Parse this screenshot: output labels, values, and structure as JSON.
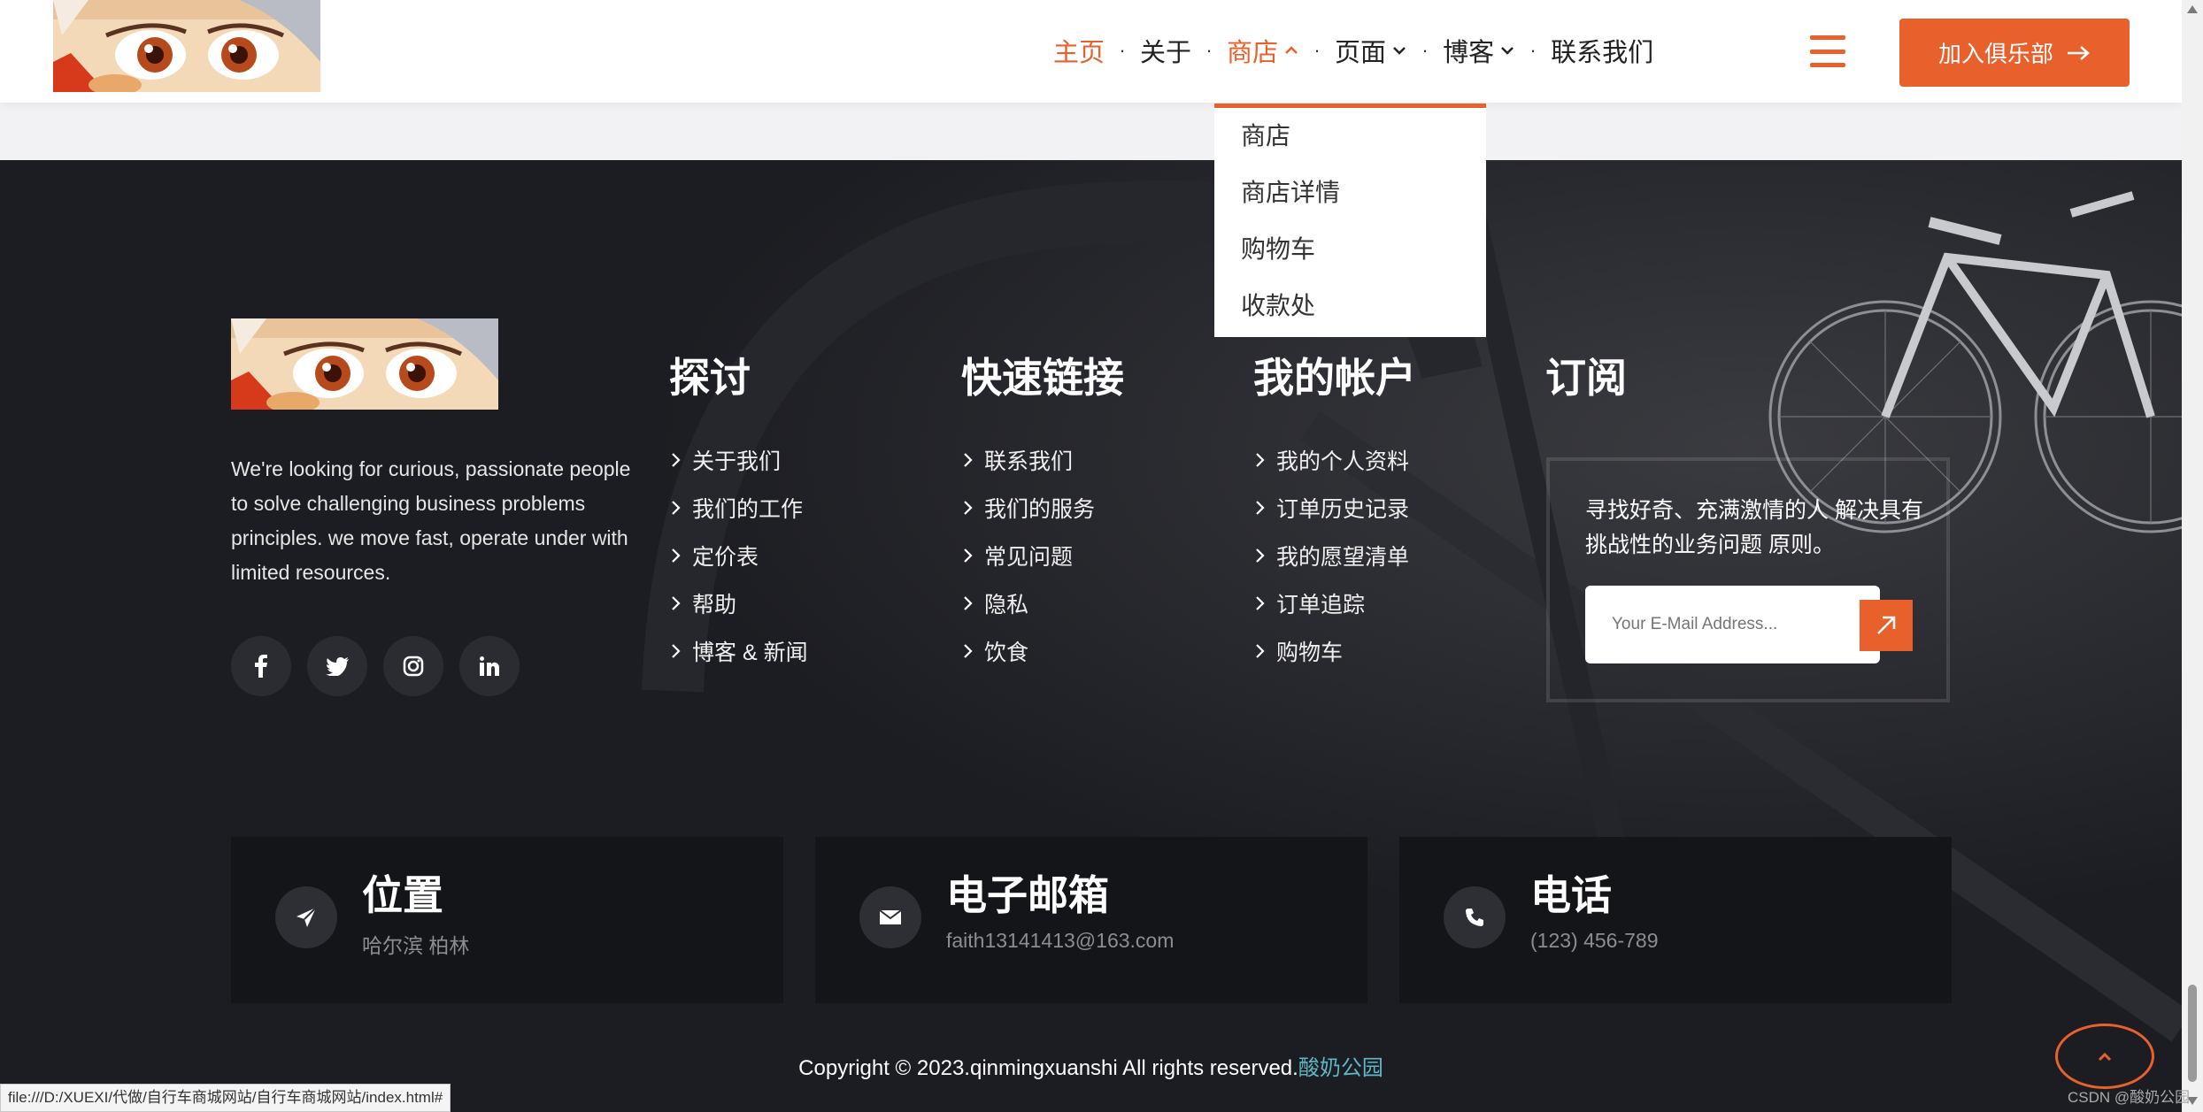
{
  "header": {
    "nav": [
      {
        "label": "主页",
        "active": true,
        "has_dropdown": false
      },
      {
        "label": "关于",
        "active": false,
        "has_dropdown": false
      },
      {
        "label": "商店",
        "active": false,
        "has_dropdown": true,
        "open": true
      },
      {
        "label": "页面",
        "active": false,
        "has_dropdown": true
      },
      {
        "label": "博客",
        "active": false,
        "has_dropdown": true
      },
      {
        "label": "联系我们",
        "active": false,
        "has_dropdown": false
      }
    ],
    "separator": "·",
    "join_button": "加入俱乐部"
  },
  "shop_dropdown": [
    "商店",
    "商店详情",
    "购物车",
    "收款处"
  ],
  "footer": {
    "about_text": "We're looking for curious, passionate people to solve challenging business problems principles. we move fast, operate under with limited resources.",
    "socials": [
      "facebook-icon",
      "twitter-icon",
      "instagram-icon",
      "linkedin-icon"
    ],
    "columns": [
      {
        "title": "探讨",
        "links": [
          "关于我们",
          "我们的工作",
          "定价表",
          "帮助",
          "博客 & 新闻"
        ]
      },
      {
        "title": "快速链接",
        "links": [
          "联系我们",
          "我们的服务",
          "常见问题",
          "隐私",
          "饮食"
        ]
      },
      {
        "title": "我的帐户",
        "links": [
          "我的个人资料",
          "订单历史记录",
          "我的愿望清单",
          "订单追踪",
          "购物车"
        ]
      }
    ],
    "subscribe": {
      "title": "订阅",
      "text": "寻找好奇、充满激情的人 解决具有挑战性的业务问题 原则。",
      "placeholder": "Your E-Mail Address..."
    },
    "info_cards": [
      {
        "title": "位置",
        "value": "哈尔滨 柏林",
        "icon": "paper-plane-icon"
      },
      {
        "title": "电子邮箱",
        "value": "faith13141413@163.com",
        "icon": "envelope-icon"
      },
      {
        "title": "电话",
        "value": "(123) 456-789",
        "icon": "phone-icon"
      }
    ],
    "copyright_text": "Copyright © 2023.qinmingxuanshi All rights reserved.",
    "copyright_brand": "酸奶公园"
  },
  "browser": {
    "status_url": "file:///D:/XUEXI/代做/自行车商城网站/自行车商城网站/index.html#",
    "watermark": "CSDN @酸奶公园"
  },
  "colors": {
    "accent": "#e8612c",
    "footer_bg": "#1c1d22",
    "card_bg": "#141519",
    "link_teal": "#5fb7c5"
  }
}
